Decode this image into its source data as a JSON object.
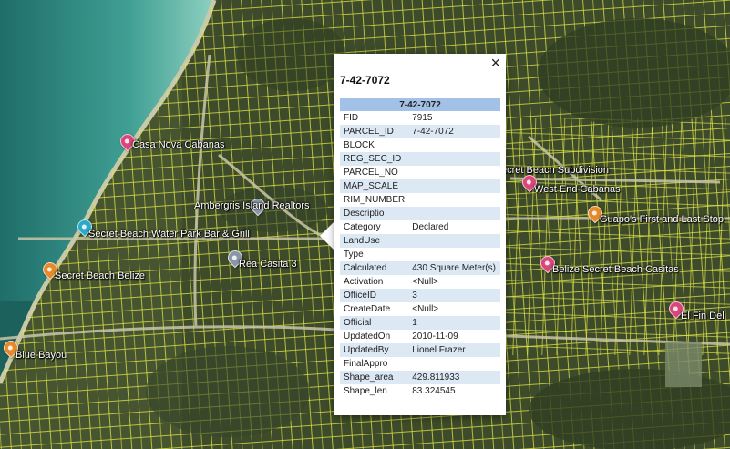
{
  "map": {
    "pois": [
      {
        "name": "Casa Nova Cabanas",
        "pin_color": "#d9467a",
        "icon": "lodging-pin-icon"
      },
      {
        "name": "Ambergris Island Realtors",
        "pin_color": "#8a96a6",
        "icon": "business-pin-icon"
      },
      {
        "name": "Secret Beach Water Park Bar & Grill",
        "pin_color": "#2aa9c9",
        "icon": "bar-pin-icon"
      },
      {
        "name": "Rea Casita 3",
        "pin_color": "#8a96a6",
        "icon": "place-pin-icon"
      },
      {
        "name": "Secret Beach Belize",
        "pin_color": "#e58a2b",
        "icon": "attraction-pin-icon"
      },
      {
        "name": "Blue Bayou",
        "pin_color": "#e58a2b",
        "icon": "restaurant-pin-icon"
      },
      {
        "name": "ecret Beach Subdivision",
        "pin_color": "",
        "icon": ""
      },
      {
        "name": "West End Cabanas",
        "pin_color": "#d9467a",
        "icon": "lodging-pin-icon"
      },
      {
        "name": "Guapo's First and Last Stop",
        "pin_color": "#e58a2b",
        "icon": "restaurant-pin-icon"
      },
      {
        "name": "Belize Secret Beach Casitas",
        "pin_color": "#d9467a",
        "icon": "lodging-pin-icon"
      },
      {
        "name": "El Fin Del",
        "pin_color": "#d9467a",
        "icon": "lodging-pin-icon"
      }
    ]
  },
  "popup": {
    "title": "7-42-7072",
    "close_icon": "×",
    "table_header": "7-42-7072",
    "rows": [
      {
        "key": "FID",
        "value": "7915"
      },
      {
        "key": "PARCEL_ID",
        "value": "7-42-7072"
      },
      {
        "key": "BLOCK",
        "value": ""
      },
      {
        "key": "REG_SEC_ID",
        "value": ""
      },
      {
        "key": "PARCEL_NO",
        "value": ""
      },
      {
        "key": "MAP_SCALE",
        "value": ""
      },
      {
        "key": "RIM_NUMBER",
        "value": ""
      },
      {
        "key": "Descriptio",
        "value": ""
      },
      {
        "key": "Category",
        "value": "Declared"
      },
      {
        "key": "LandUse",
        "value": ""
      },
      {
        "key": "Type",
        "value": ""
      },
      {
        "key": "Calculated",
        "value": "430 Square Meter(s)"
      },
      {
        "key": "Activation",
        "value": "<Null>"
      },
      {
        "key": "OfficeID",
        "value": "3"
      },
      {
        "key": "CreateDate",
        "value": "<Null>"
      },
      {
        "key": "Official",
        "value": "1"
      },
      {
        "key": "UpdatedOn",
        "value": "2010-11-09"
      },
      {
        "key": "UpdatedBy",
        "value": "Lionel Frazer"
      },
      {
        "key": "FinalAppro",
        "value": ""
      },
      {
        "key": "Shape_area",
        "value": "429.811933"
      },
      {
        "key": "Shape_len",
        "value": "83.324545"
      }
    ]
  }
}
